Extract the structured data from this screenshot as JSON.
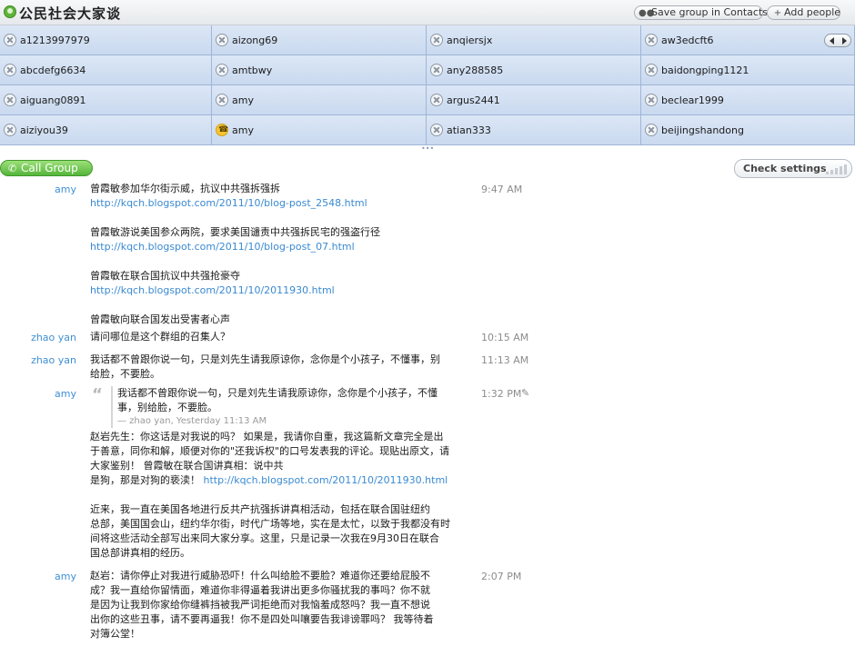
{
  "header": {
    "title": "公民社会大家谈",
    "save_label": "Save group in Contacts",
    "add_label": "Add people"
  },
  "participants": [
    {
      "name": "a1213997979",
      "status": "offline"
    },
    {
      "name": "aizong69",
      "status": "offline"
    },
    {
      "name": "anqiersjx",
      "status": "offline"
    },
    {
      "name": "aw3edcft6",
      "status": "offline"
    },
    {
      "name": "abcdefg6634",
      "status": "offline"
    },
    {
      "name": "amtbwy",
      "status": "offline"
    },
    {
      "name": "any288585",
      "status": "offline"
    },
    {
      "name": "baidongping1121",
      "status": "offline"
    },
    {
      "name": "aiguang0891",
      "status": "offline"
    },
    {
      "name": "amy",
      "status": "offline"
    },
    {
      "name": "argus2441",
      "status": "offline"
    },
    {
      "name": "beclear1999",
      "status": "offline"
    },
    {
      "name": "aiziyou39",
      "status": "offline"
    },
    {
      "name": "amy",
      "status": "ringing"
    },
    {
      "name": "atian333",
      "status": "offline"
    },
    {
      "name": "beijingshandong",
      "status": "offline"
    }
  ],
  "toolbar": {
    "call_label": "Call Group",
    "check_label": "Check settings"
  },
  "messages": [
    {
      "sender": "amy",
      "time": "9:47 AM",
      "lines": [
        {
          "text": "曾霞敏参加华尔街示威，抗议中共强拆强拆",
          "link": false
        },
        {
          "text": "http://kqch.blogspot.com/2011/10/blog-post_2548.html",
          "link": true
        },
        {
          "text": "",
          "link": false
        },
        {
          "text": "曾霞敏游说美国参众两院，要求美国谴责中共强拆民宅的强盗行径",
          "link": false
        },
        {
          "text": "http://kqch.blogspot.com/2011/10/blog-post_07.html",
          "link": true
        },
        {
          "text": "",
          "link": false
        },
        {
          "text": "曾霞敏在联合国抗议中共强抢豪夺",
          "link": false
        },
        {
          "text": "http://kqch.blogspot.com/2011/10/2011930.html",
          "link": true
        },
        {
          "text": "",
          "link": false
        },
        {
          "text": "曾霞敏向联合国发出受害者心声",
          "link": false
        }
      ]
    },
    {
      "sender": "zhao yan",
      "time": "10:15 AM",
      "lines": [
        {
          "text": "请问哪位是这个群组的召集人？",
          "link": false
        }
      ]
    },
    {
      "sender": "zhao yan",
      "time": "11:13 AM",
      "lines": [
        {
          "text": "我话都不曾跟你说一句，只是刘先生请我原谅你，念你是个小孩子，不懂事，别",
          "link": false
        },
        {
          "text": "给脸，不要脸。",
          "link": false
        }
      ]
    },
    {
      "sender": "amy",
      "time": "1:32 PM",
      "quote": {
        "lines": [
          "我话都不曾跟你说一句，只是刘先生请我原谅你，念你是个小孩子，不懂",
          "事，别给脸，不要脸。"
        ],
        "by": "— zhao yan, Yesterday 11:13 AM"
      },
      "lines": [
        {
          "text": "赵岩先生：你这话是对我说的吗？ 如果是，我请你自重，我这篇新文章完全是出",
          "link": false
        },
        {
          "text": "于善意，同你和解，顺便对你的\"还我诉权\"的口号发表我的评论。现贴出原文，请",
          "link": false
        },
        {
          "text": "大家鉴别！                    曾霞敏在联合国讲真相：说中共",
          "link": false
        },
        {
          "text": "是狗，那是对狗的亵渎！",
          "link": false,
          "tail_link": "http://kqch.blogspot.com/2011/10/2011930.html"
        },
        {
          "text": "",
          "link": false
        },
        {
          "text": " 近来，我一直在美国各地进行反共产抗强拆讲真相活动，包括在联合国驻纽约",
          "link": false
        },
        {
          "text": "总部，美国国会山，纽约华尔街，时代广场等地，实在是太忙，以致于我都没有时",
          "link": false
        },
        {
          "text": "间将这些活动全部写出来同大家分享。这里，只是记录一次我在9月30日在联合",
          "link": false
        },
        {
          "text": "国总部讲真相的经历。",
          "link": false
        }
      ]
    },
    {
      "sender": "amy",
      "time": "2:07 PM",
      "lines": [
        {
          "text": "赵岩：请你停止对我进行威胁恐吓！什么叫给脸不要脸？难道你还要给屁股不",
          "link": false
        },
        {
          "text": "成？我一直给你留情面，难道你非得逼着我讲出更多你骚扰我的事吗？你不就",
          "link": false
        },
        {
          "text": "是因为让我到你家给你缝裤挡被我严词拒绝而对我恼羞成怒吗？我一直不想说",
          "link": false
        },
        {
          "text": "出你的这些丑事，请不要再逼我！你不是四处叫嚷要告我诽谤罪吗？ 我等待着",
          "link": false
        },
        {
          "text": "对簿公堂！",
          "link": false
        }
      ]
    }
  ]
}
